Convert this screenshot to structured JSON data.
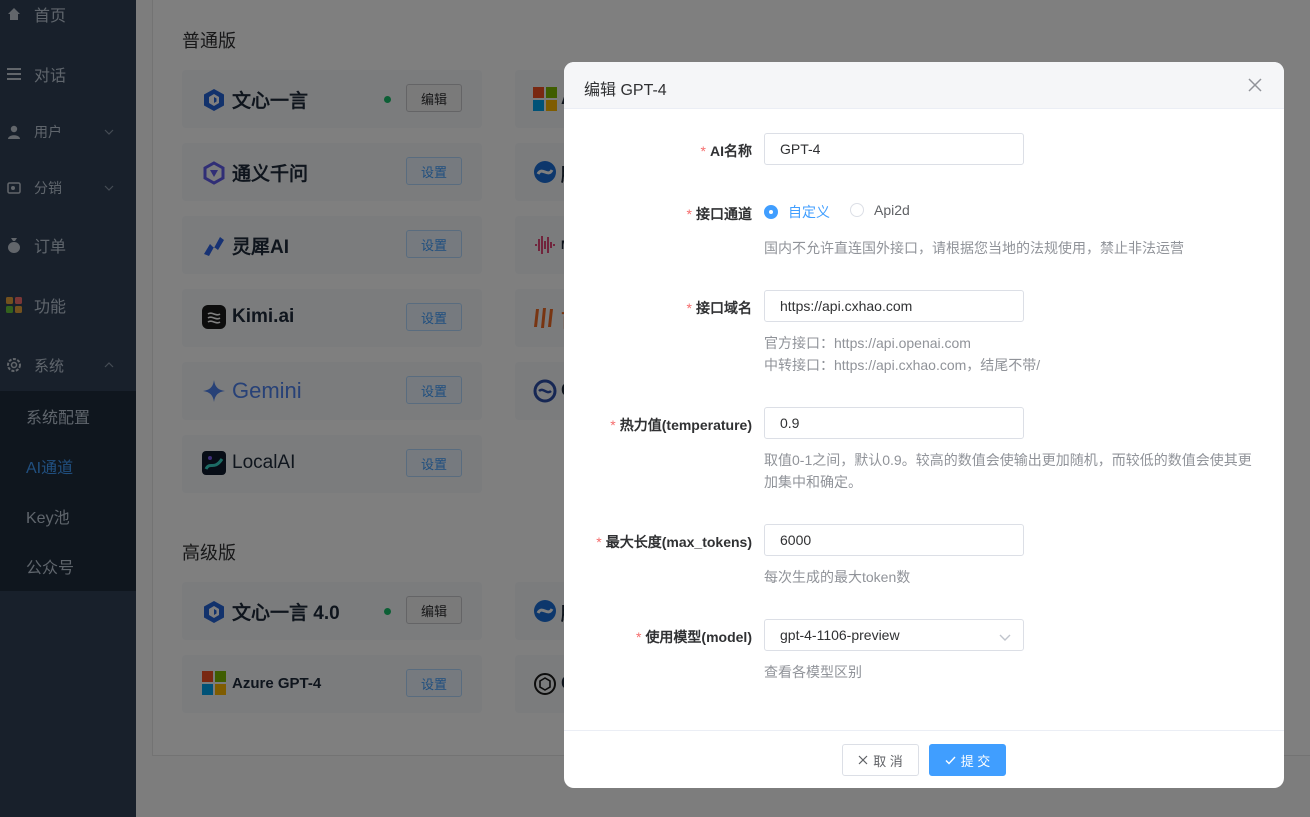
{
  "sidebar": {
    "items": [
      {
        "label": "首页",
        "icon": "home-icon"
      },
      {
        "label": "对话",
        "icon": "list-icon"
      },
      {
        "label": "用户",
        "icon": "user-icon"
      },
      {
        "label": "分销",
        "icon": "share-icon"
      },
      {
        "label": "订单",
        "icon": "money-bag-icon"
      },
      {
        "label": "功能",
        "icon": "apps-icon"
      },
      {
        "label": "系统",
        "icon": "gear-icon"
      }
    ],
    "submenu": [
      "系统配置",
      "AI通道",
      "Key池",
      "公众号"
    ]
  },
  "sections": {
    "standard": "普通版",
    "advanced": "高级版"
  },
  "cards": {
    "wenxin": {
      "name": "文心一言",
      "btn": "编辑"
    },
    "tongyi": {
      "name": "通义千问",
      "btn": "设置"
    },
    "lingxi": {
      "name": "灵犀AI",
      "btn": "设置"
    },
    "kimi": {
      "name": "Kimi.ai",
      "btn": "设置"
    },
    "gemini": {
      "name": "Gemini",
      "btn": "设置"
    },
    "localai": {
      "name": "LocalAI",
      "btn": "设置"
    },
    "wenxin4": {
      "name": "文心一言 4.0",
      "btn": "编辑"
    },
    "azure4": {
      "name": "Azure GPT-4",
      "btn": "设置"
    }
  },
  "partial_cards": [
    "Az",
    "腾",
    "M",
    "百",
    "Cl",
    "腾",
    "G"
  ],
  "dialog": {
    "title": "编辑 GPT-4",
    "fields": {
      "name": {
        "label": "AI名称",
        "value": "GPT-4"
      },
      "channel": {
        "label": "接口通道",
        "options": [
          "自定义",
          "Api2d"
        ],
        "selected": "自定义",
        "hint": "国内不允许直连国外接口，请根据您当地的法规使用，禁止非法运营"
      },
      "domain": {
        "label": "接口域名",
        "value": "https://api.cxhao.com",
        "hint1": "官方接口：https://api.openai.com",
        "hint2": "中转接口：https://api.cxhao.com，结尾不带/"
      },
      "temperature": {
        "label": "热力值(temperature)",
        "value": "0.9",
        "hint1": "取值0-1之间，默认0.9。较高的数值会使输出更加随机，而较低的数值会使其更",
        "hint2": "加集中和确定。"
      },
      "max_tokens": {
        "label": "最大长度(max_tokens)",
        "value": "6000",
        "hint": "每次生成的最大token数"
      },
      "model": {
        "label": "使用模型(model)",
        "value": "gpt-4-1106-preview",
        "hint": "查看各模型区别"
      }
    },
    "cancel": "取 消",
    "submit": "提 交"
  }
}
